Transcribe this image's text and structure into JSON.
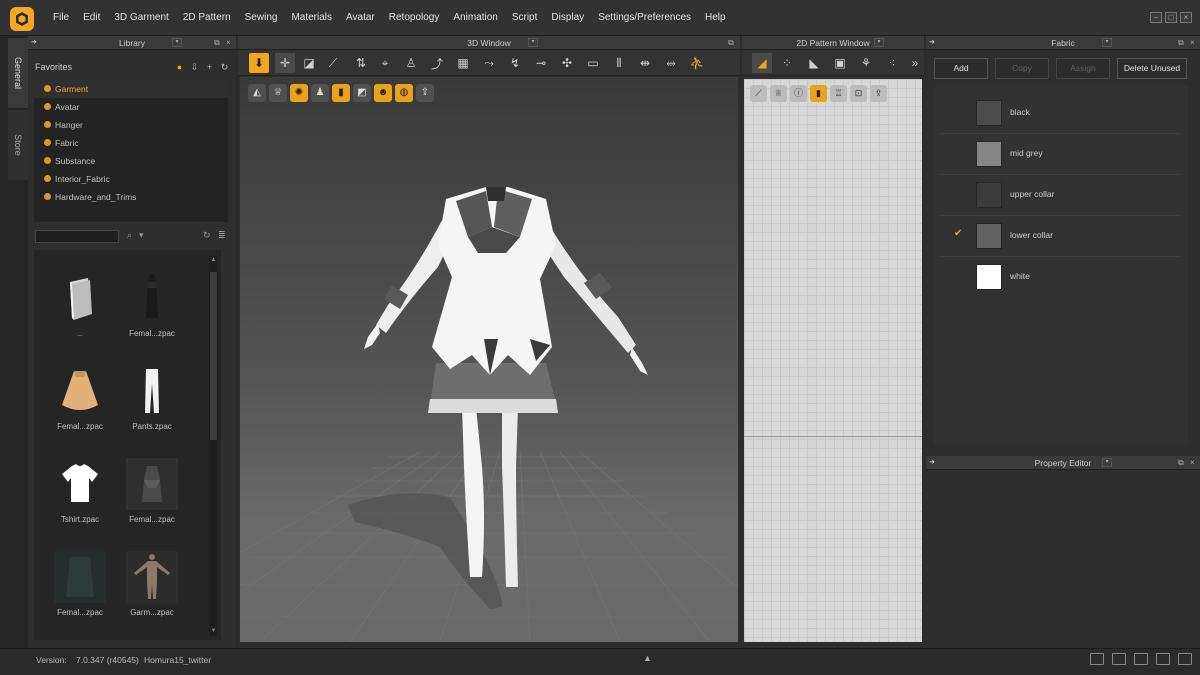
{
  "menu": [
    "File",
    "Edit",
    "3D Garment",
    "2D Pattern",
    "Sewing",
    "Materials",
    "Avatar",
    "Retopology",
    "Animation",
    "Script",
    "Display",
    "Settings/Preferences",
    "Help"
  ],
  "side_tabs": {
    "general": "General",
    "store": "Store"
  },
  "library": {
    "title": "Library",
    "favorites_label": "Favorites",
    "favorites": [
      "Garment",
      "Avatar",
      "Hanger",
      "Fabric",
      "Substance",
      "Interior_Fabric",
      "Hardware_and_Trims"
    ],
    "selected_favorite": "Garment",
    "search_placeholder": "",
    "items": [
      {
        "label": "..",
        "icon": "folder-icon"
      },
      {
        "label": "Femal...zpac",
        "icon": "dress-thumbnail-icon"
      },
      {
        "label": "Femal...zpac",
        "icon": "skirt-thumbnail-icon"
      },
      {
        "label": "Pants.zpac",
        "icon": "pants-thumbnail-icon"
      },
      {
        "label": "Tshirt.zpac",
        "icon": "tshirt-thumbnail-icon"
      },
      {
        "label": "Femal...zpac",
        "icon": "outfit-thumbnail-icon"
      },
      {
        "label": "Femal...zpac",
        "icon": "coat-thumbnail-icon"
      },
      {
        "label": "Garm...zpac",
        "icon": "avatar-thumbnail-icon"
      }
    ]
  },
  "window3d": {
    "title": "3D Window"
  },
  "window2d": {
    "title": "2D Pattern Window"
  },
  "fabric": {
    "title": "Fabric",
    "buttons": {
      "add": "Add",
      "copy": "Copy",
      "assign": "Assign",
      "delete_unused": "Delete Unused"
    },
    "items": [
      {
        "name": "black",
        "color": "#4b4b4b",
        "checked": false
      },
      {
        "name": "mid grey",
        "color": "#858585",
        "checked": false
      },
      {
        "name": "upper collar",
        "color": "#3c3c3c",
        "checked": false
      },
      {
        "name": "lower collar",
        "color": "#626262",
        "checked": true
      },
      {
        "name": "white",
        "color": "#ffffff",
        "checked": false
      }
    ]
  },
  "property_editor": {
    "title": "Property Editor"
  },
  "status": {
    "version_label": "Version:",
    "version": "7.0.347 (r40545)",
    "project": "Homura15_twitter"
  },
  "colors": {
    "accent": "#f2a51d",
    "background": "#2e2e2e"
  }
}
